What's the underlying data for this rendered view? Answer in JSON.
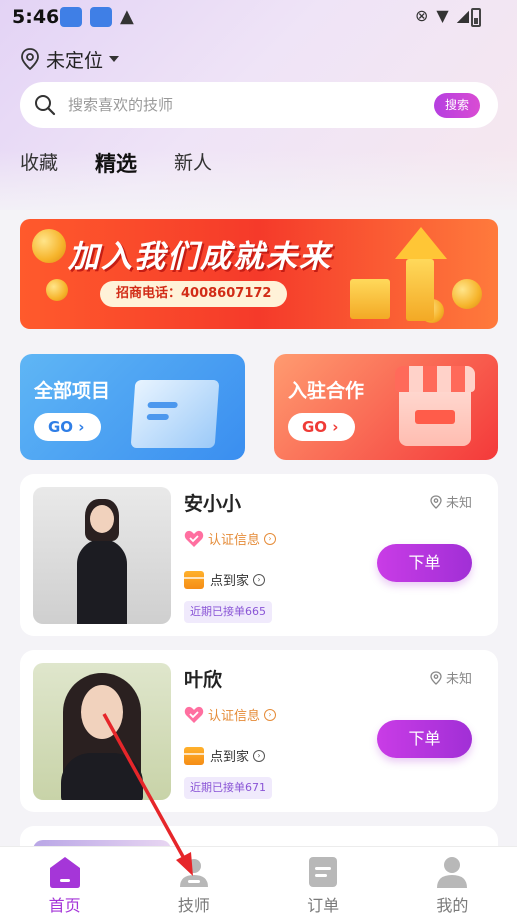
{
  "status_bar": {
    "time": "5:46"
  },
  "location": {
    "label": "未定位"
  },
  "search": {
    "placeholder": "搜索喜欢的技师",
    "button_label": "搜索"
  },
  "tabs": [
    {
      "label": "收藏",
      "active": false
    },
    {
      "label": "精选",
      "active": true
    },
    {
      "label": "新人",
      "active": false
    }
  ],
  "banner": {
    "title": "加入我们成就未来",
    "phone": "招商电话：4008607172"
  },
  "quick_cards": [
    {
      "title": "全部项目",
      "go_label": "GO"
    },
    {
      "title": "入驻合作",
      "go_label": "GO"
    }
  ],
  "technicians": [
    {
      "name": "安小小",
      "location": "未知",
      "verify": "认证信息",
      "service": "点到家",
      "recent": "近期已接单665",
      "order_label": "下单"
    },
    {
      "name": "叶欣",
      "location": "未知",
      "verify": "认证信息",
      "service": "点到家",
      "recent": "近期已接单671",
      "order_label": "下单"
    }
  ],
  "bottom_nav": [
    {
      "label": "首页",
      "active": true
    },
    {
      "label": "技师",
      "active": false
    },
    {
      "label": "订单",
      "active": false
    },
    {
      "label": "我的",
      "active": false
    }
  ],
  "colors": {
    "accent": "#a536d8",
    "banner_red": "#f53a2a",
    "card_blue": "#3a8ef0",
    "card_red": "#f4393a"
  }
}
